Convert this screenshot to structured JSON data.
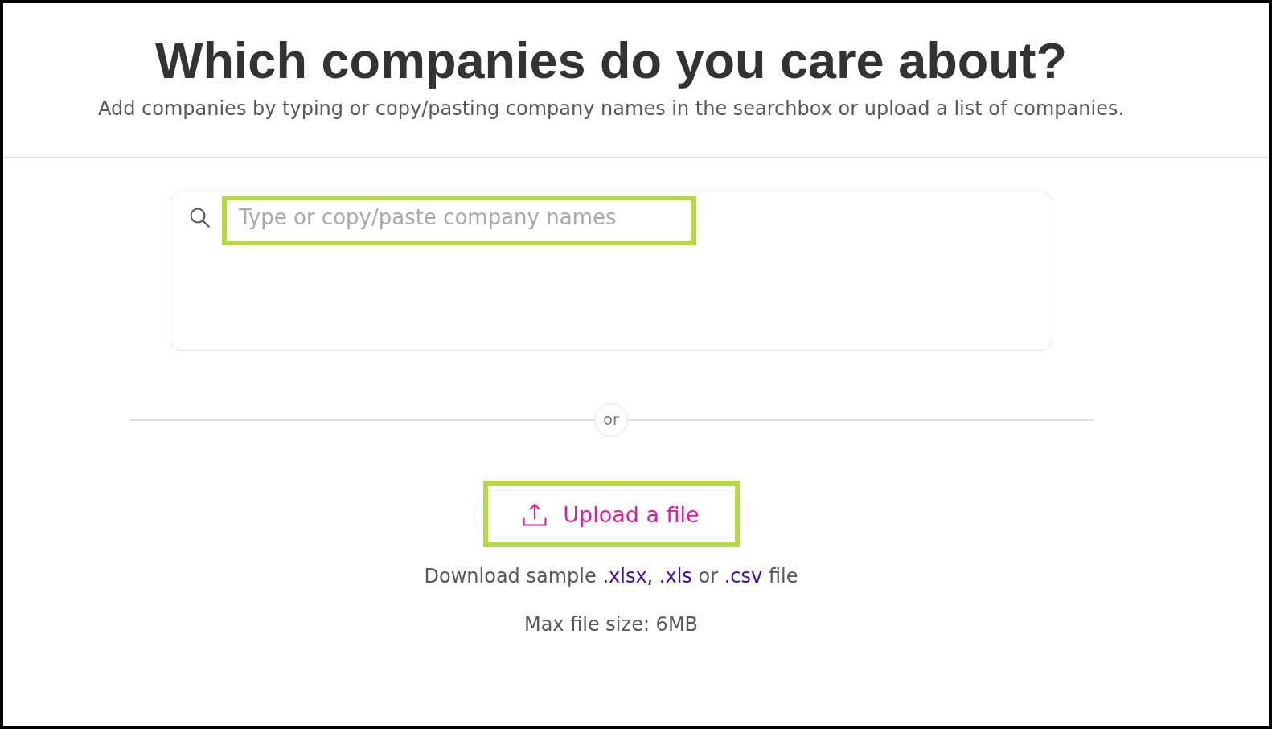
{
  "header": {
    "title": "Which companies do you care about?",
    "subtitle": "Add companies by typing or copy/pasting company names in the searchbox or upload a list of companies."
  },
  "search": {
    "placeholder": "Type or copy/paste company names",
    "highlighted": true
  },
  "separator": {
    "label": "or"
  },
  "upload": {
    "button": {
      "label": "Upload a file",
      "highlighted": true
    },
    "sample_line": [
      {
        "kind": "text",
        "text": "Download sample"
      },
      {
        "kind": "link",
        "text": ".xlsx,"
      },
      {
        "kind": "link",
        "text": ".xls"
      },
      {
        "kind": "text",
        "text": "or"
      },
      {
        "kind": "link",
        "text": ".csv"
      },
      {
        "kind": "text",
        "text": "file"
      }
    ],
    "size_note": "Max file size: 6MB"
  }
}
